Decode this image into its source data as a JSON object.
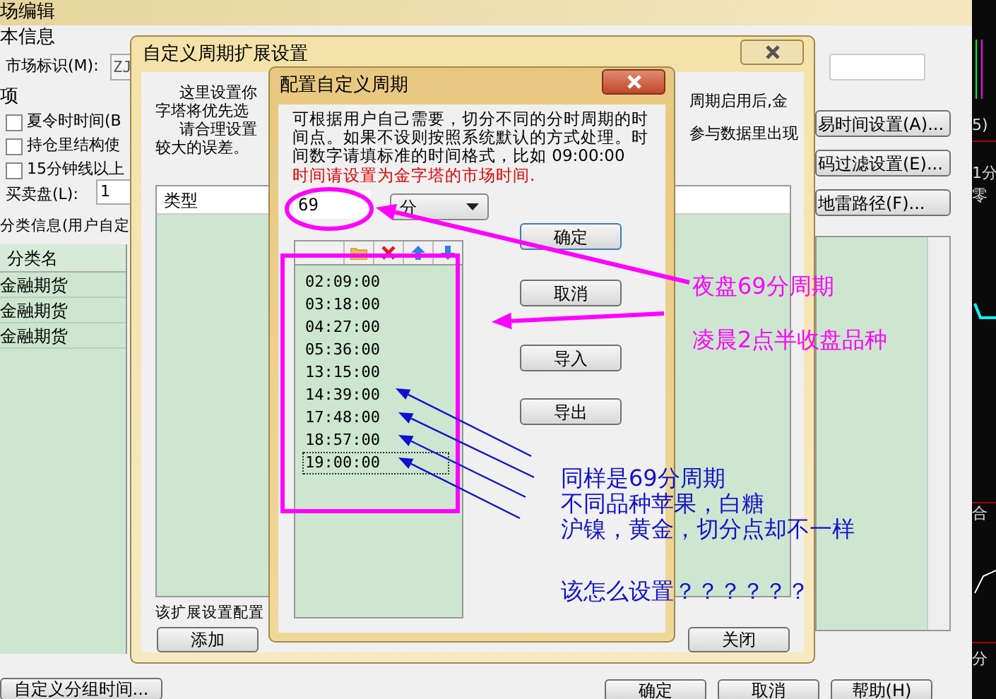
{
  "editor_window": {
    "title": "场编辑",
    "basic_info_label": "本信息",
    "market_id_label": "市场标识(M):",
    "market_id_value": "ZJ",
    "options_label": "项",
    "options": [
      {
        "label": "夏令时时间(B",
        "checked": false
      },
      {
        "label": "持仓里结构使",
        "checked": false
      },
      {
        "label": "15分钟线以上",
        "checked": false
      }
    ],
    "bid_ask_label": "买卖盘(L):",
    "bid_ask_value": "1",
    "category_label": "分类信息(用户自定",
    "table": {
      "columns": [
        "分类名"
      ],
      "rows": [
        "金融期货",
        "金融期货",
        "金融期货"
      ]
    },
    "side_buttons": [
      "易时间设置(A)...",
      "码过滤设置(E)...",
      "地雷路径(F)..."
    ],
    "bottom_buttons": [
      "自定义分组时间...",
      "确定",
      "取消",
      "帮助(H)"
    ]
  },
  "chart_strip": {
    "labels": [
      "5)",
      "1分",
      "零",
      "合",
      "分"
    ]
  },
  "extension_window": {
    "title": "自定义周期扩展设置",
    "intro_left": [
      "这里设置你",
      "字塔将优先选",
      "请合理设置",
      "较大的误差。"
    ],
    "intro_right": [
      "周期启用后,金",
      "参与数据里出现"
    ],
    "list_header": "类型",
    "note": "该扩展设置配置",
    "buttons": [
      "添加",
      "关闭"
    ]
  },
  "config_window": {
    "title": "配置自定义周期",
    "description": "可根据用户自己需要，切分不同的分时周期的时间点。如果不设则按照系统默认的方式处理。时间数字请填标准的时间格式，比如 09:00:00",
    "warning": "时间请设置为金字塔的市场时间.",
    "period_value": "69",
    "unit": "分",
    "times": [
      {
        "text": "02:09:00",
        "selected": false
      },
      {
        "text": "03:18:00",
        "selected": false
      },
      {
        "text": "04:27:00",
        "selected": false
      },
      {
        "text": "05:36:00",
        "selected": false
      },
      {
        "text": "13:15:00",
        "selected": false
      },
      {
        "text": "14:39:00",
        "selected": false
      },
      {
        "text": "17:48:00",
        "selected": false
      },
      {
        "text": "18:57:00",
        "selected": false
      },
      {
        "text": "19:00:00",
        "selected": true
      }
    ],
    "buttons": [
      "确定",
      "取消",
      "导入",
      "导出"
    ]
  },
  "annotations": {
    "magenta_notes": [
      "夜盘69分周期",
      "凌晨2点半收盘品种"
    ],
    "blue_notes": [
      "同样是69分周期",
      "不同品种苹果，白糖",
      "沪镍，黄金，切分点却不一样",
      "该怎么设置？？？？？？"
    ]
  }
}
